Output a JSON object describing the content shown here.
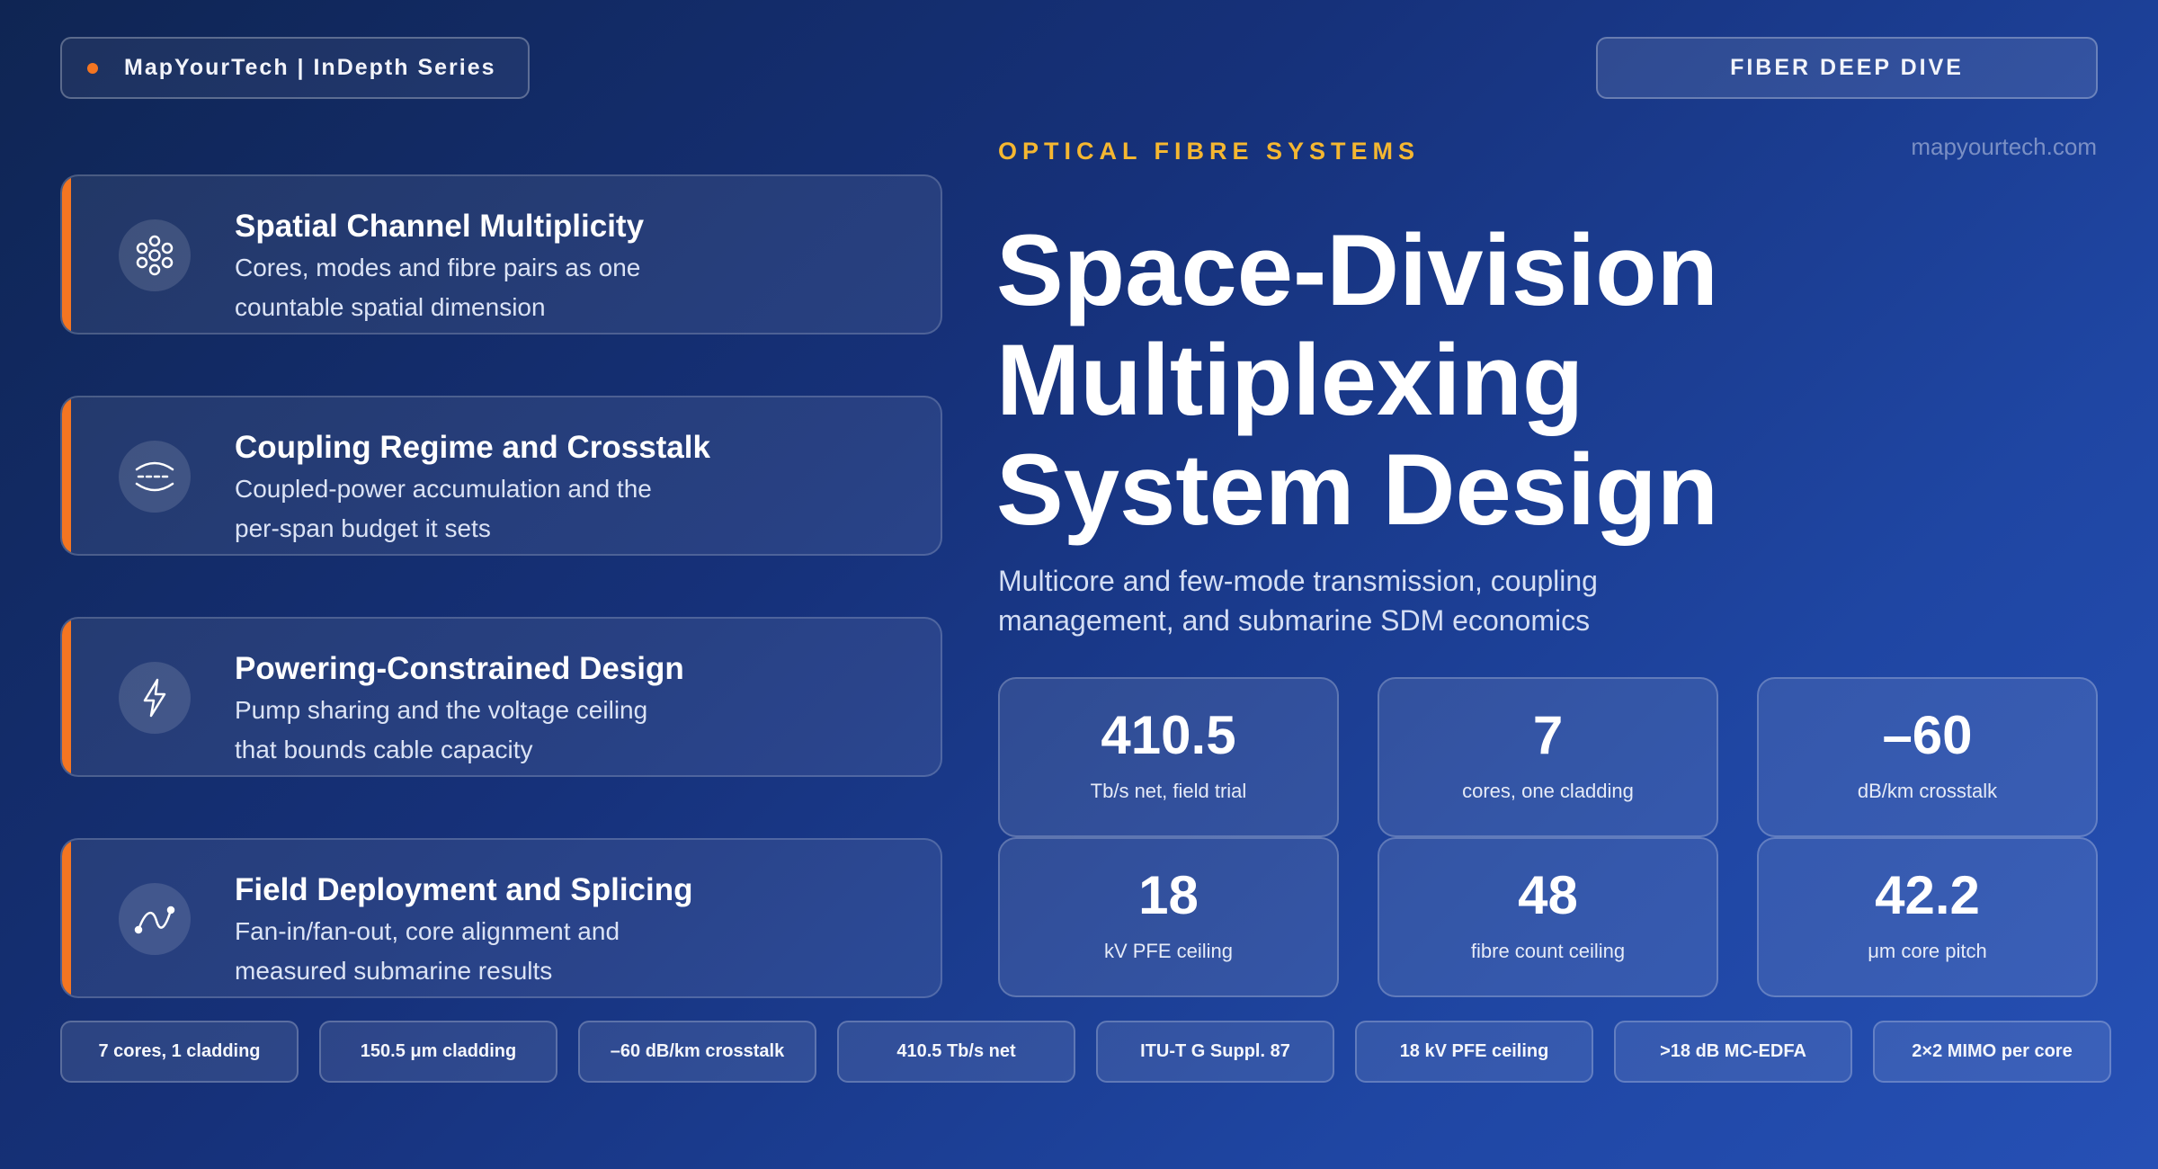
{
  "header": {
    "badge_label": "MapYourTech | InDepth Series",
    "series_pill": "FIBER DEEP DIVE",
    "website": "mapyourtech.com"
  },
  "hero": {
    "eyebrow": "OPTICAL FIBRE SYSTEMS",
    "title_lines": [
      "Space-Division",
      "Multiplexing",
      "System Design"
    ],
    "subtitle": "Multicore and few-mode transmission, coupling management, and submarine SDM economics"
  },
  "topics": [
    {
      "icon": "cores-cluster-icon",
      "title": "Spatial Channel Multiplicity",
      "desc_lines": [
        "Cores, modes and fibre pairs as one",
        "countable spatial dimension"
      ]
    },
    {
      "icon": "coupling-icon",
      "title": "Coupling Regime and Crosstalk",
      "desc_lines": [
        "Coupled-power accumulation and the",
        "per-span budget it sets"
      ]
    },
    {
      "icon": "lightning-icon",
      "title": "Powering-Constrained Design",
      "desc_lines": [
        "Pump sharing and the voltage ceiling",
        "that bounds cable capacity"
      ]
    },
    {
      "icon": "wave-curve-icon",
      "title": "Field Deployment and Splicing",
      "desc_lines": [
        "Fan-in/fan-out, core alignment and",
        "measured submarine results"
      ]
    }
  ],
  "stats": [
    {
      "value": "410.5",
      "label": "Tb/s net, field trial"
    },
    {
      "value": "7",
      "label": "cores, one cladding"
    },
    {
      "value": "–60",
      "label": "dB/km crosstalk"
    },
    {
      "value": "18",
      "label": "kV PFE ceiling"
    },
    {
      "value": "48",
      "label": "fibre count ceiling"
    },
    {
      "value": "42.2",
      "label": "μm core pitch"
    }
  ],
  "chips": [
    "7 cores, 1 cladding",
    "150.5 μm cladding",
    "–60 dB/km crosstalk",
    "410.5 Tb/s net",
    "ITU-T G Suppl. 87",
    "18 kV PFE ceiling",
    ">18 dB MC-EDFA",
    "2×2 MIMO per core"
  ],
  "colors": {
    "accent_orange": "#f47521",
    "eyebrow_gold": "#f5b731",
    "background_dark": "#0f2553",
    "background_light": "#2650b5"
  }
}
